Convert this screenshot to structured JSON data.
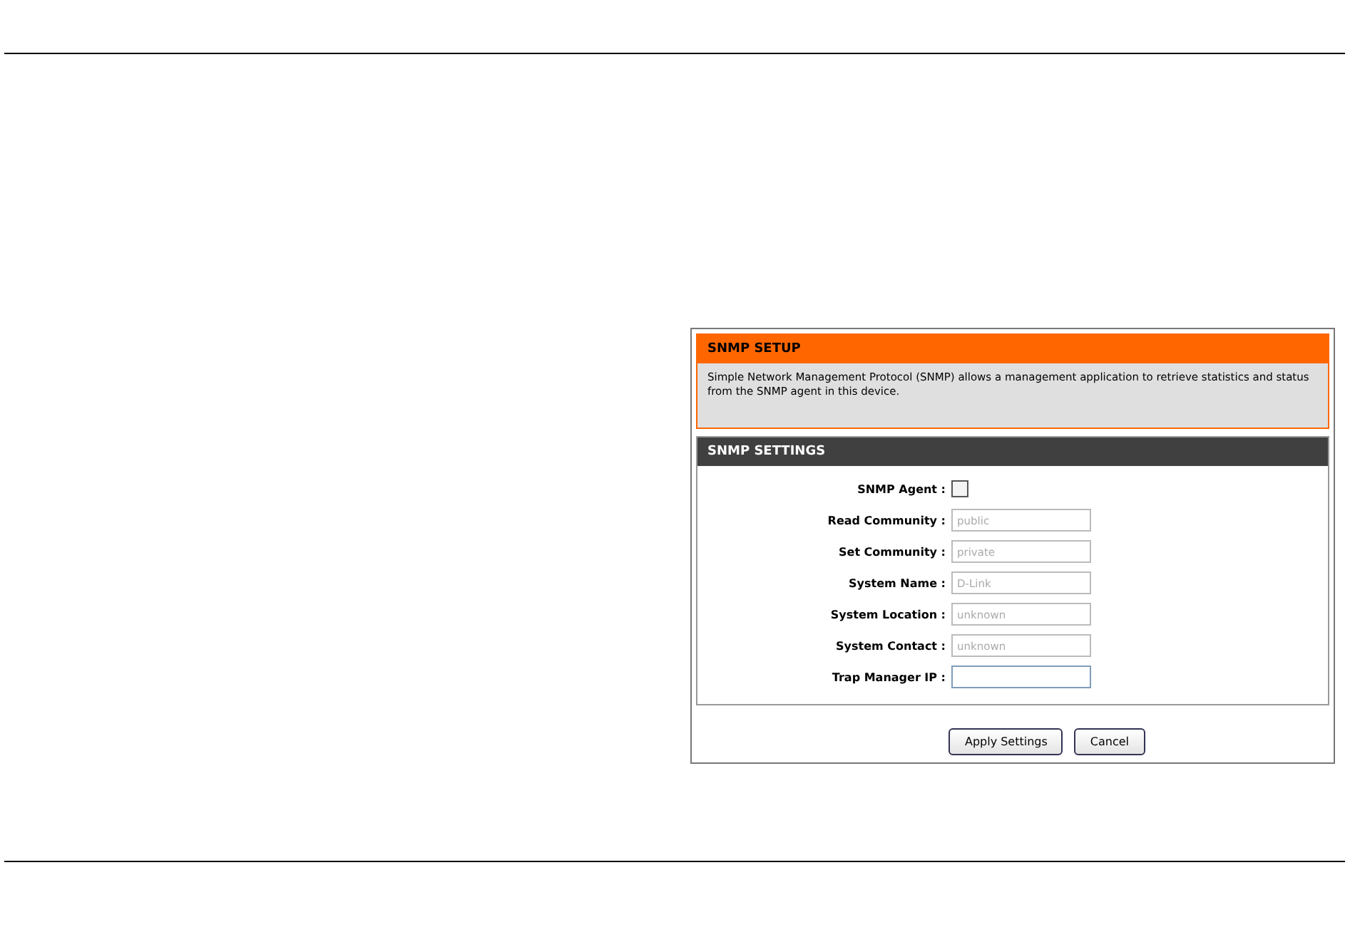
{
  "setup": {
    "title": "SNMP SETUP",
    "description": "Simple Network Management Protocol (SNMP) allows a management application to retrieve statistics and status from the SNMP agent in this device."
  },
  "settings": {
    "title": "SNMP SETTINGS",
    "agent": {
      "label": "SNMP Agent :",
      "checked": false
    },
    "fields": [
      {
        "label": "Read Community :",
        "value": "public",
        "disabled": true
      },
      {
        "label": "Set Community :",
        "value": "private",
        "disabled": true
      },
      {
        "label": "System Name :",
        "value": "D-Link",
        "disabled": true
      },
      {
        "label": "System Location :",
        "value": "unknown",
        "disabled": true
      },
      {
        "label": "System Contact :",
        "value": "unknown",
        "disabled": true
      },
      {
        "label": "Trap Manager IP :",
        "disabled": false
      }
    ]
  },
  "buttons": [
    "Apply Settings",
    "Cancel"
  ]
}
